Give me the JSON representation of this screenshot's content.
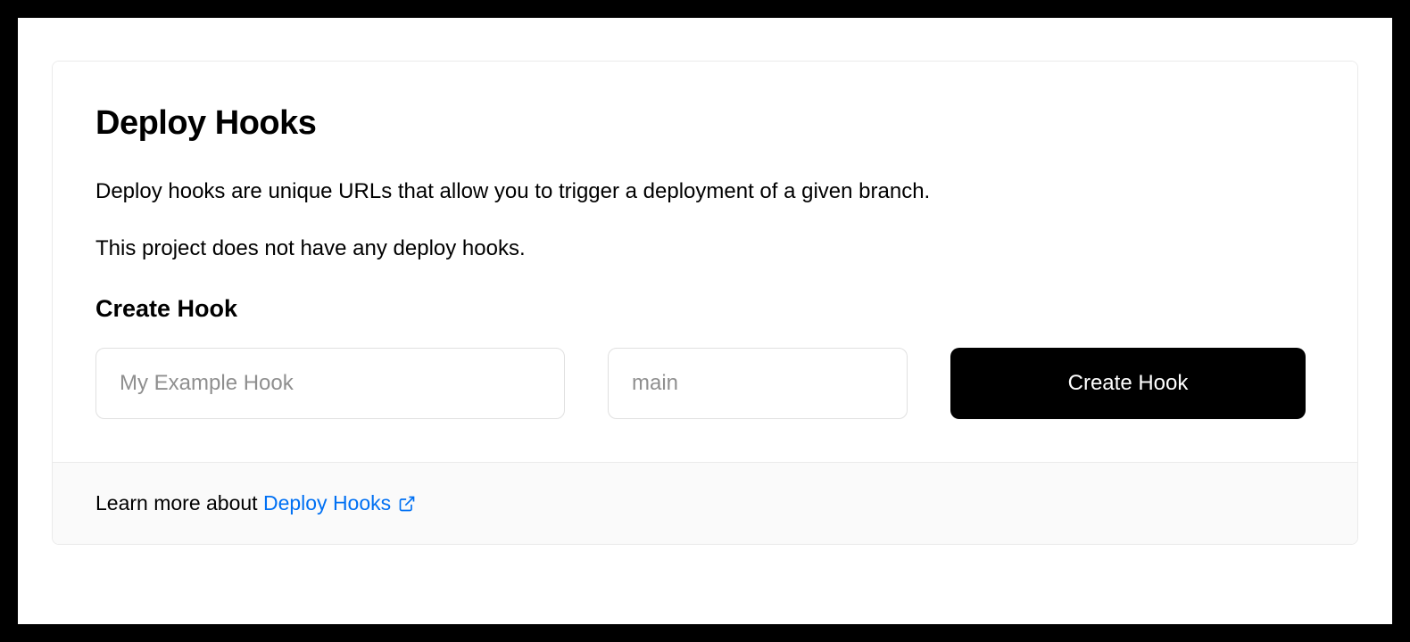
{
  "card": {
    "title": "Deploy Hooks",
    "description": "Deploy hooks are unique URLs that allow you to trigger a deployment of a given branch.",
    "empty_state": "This project does not have any deploy hooks.",
    "section_heading": "Create Hook",
    "form": {
      "name_placeholder": "My Example Hook",
      "branch_placeholder": "main",
      "submit_label": "Create Hook"
    },
    "footer": {
      "prefix": "Learn more about ",
      "link_text": "Deploy Hooks"
    }
  }
}
